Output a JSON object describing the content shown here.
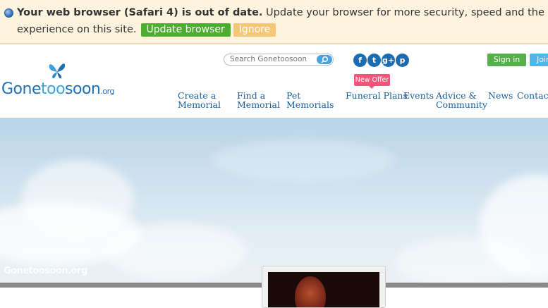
{
  "banner": {
    "bold_text": "Your web browser (Safari 4) is out of date.",
    "text_line1": " Update your browser for more security, speed and the best",
    "text_line2": "experience on this site.",
    "update_label": "Update browser",
    "ignore_label": "Ignore"
  },
  "logo": {
    "part1": "Gone",
    "part2": "too",
    "part3": "soon",
    "suffix": ".org"
  },
  "search": {
    "placeholder": "Search Gonetoosoon"
  },
  "social": {
    "facebook": "f",
    "twitter": "t",
    "googleplus": "g+",
    "pinterest": "p"
  },
  "account": {
    "signin_label": "Sign in",
    "join_label": "Join"
  },
  "new_offer": "New Offer",
  "nav": [
    {
      "line1": "Create a",
      "line2": "Memorial"
    },
    {
      "line1": "Find a",
      "line2": "Memorial"
    },
    {
      "line1": "Pet",
      "line2": "Memorials"
    },
    {
      "line1": "Funeral Plans",
      "line2": ""
    },
    {
      "line1": "Events",
      "line2": ""
    },
    {
      "line1": "Advice &",
      "line2": "Community"
    },
    {
      "line1": "News",
      "line2": ""
    },
    {
      "line1": "Contact",
      "line2": ""
    }
  ],
  "hero": {
    "watermark": "Gonetoosoon.org"
  },
  "colors": {
    "brand": "#1f6fb6",
    "signin": "#56b04a",
    "join": "#51b6e8",
    "offer": "#f0557a"
  }
}
